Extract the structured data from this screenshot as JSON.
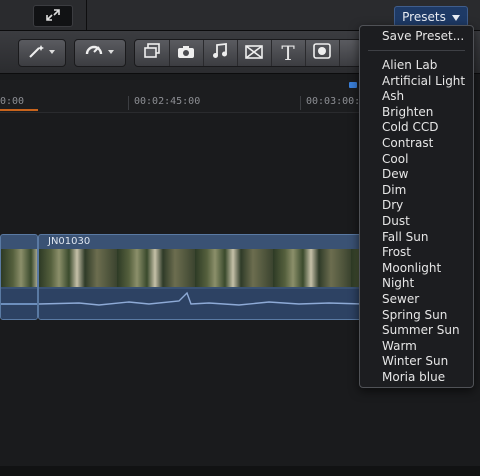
{
  "toolbar": {
    "presets_label": "Presets",
    "tools": [
      "magic-wand-icon",
      "rotate-icon",
      "layers-icon",
      "camera-icon",
      "music-icon",
      "transition-icon",
      "title-icon",
      "generator-icon"
    ],
    "title_glyph": "T"
  },
  "ruler": {
    "labels": [
      "0:00",
      "00:02:45:00",
      "00:03:00:"
    ]
  },
  "clip": {
    "name": "JN01030"
  },
  "presets_menu": {
    "save_preset": "Save Preset...",
    "items": [
      "Alien Lab",
      "Artificial Light",
      "Ash",
      "Brighten",
      "Cold CCD",
      "Contrast",
      "Cool",
      "Dew",
      "Dim",
      "Dry",
      "Dust",
      "Fall Sun",
      "Frost",
      "Moonlight",
      "Night",
      "Sewer",
      "Spring Sun",
      "Summer Sun",
      "Warm",
      "Winter Sun",
      "Moria blue"
    ]
  },
  "colors": {
    "accent": "#1e3a66",
    "clip": "#3a5274",
    "playhead": "#c8641c"
  }
}
